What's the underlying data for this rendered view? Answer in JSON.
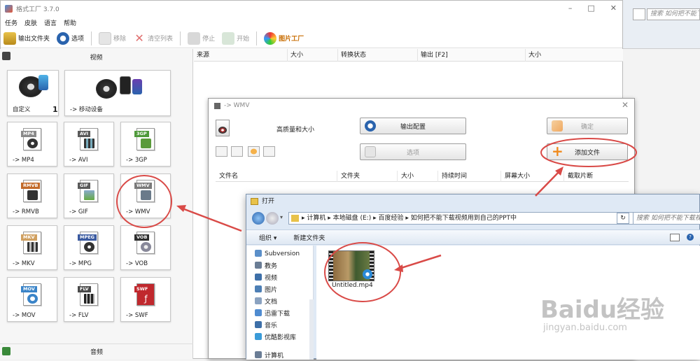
{
  "main_window": {
    "title": "格式工厂 3.7.0",
    "menu": [
      "任务",
      "皮肤",
      "语言",
      "帮助"
    ],
    "toolbar": [
      {
        "label": "输出文件夹",
        "icon": "folder-icon",
        "enabled": true
      },
      {
        "label": "选项",
        "icon": "options-icon",
        "enabled": true
      },
      {
        "label": "移除",
        "icon": "remove-icon",
        "enabled": false
      },
      {
        "label": "清空列表",
        "icon": "clear-list-icon",
        "enabled": false
      },
      {
        "label": "停止",
        "icon": "stop-icon",
        "enabled": false
      },
      {
        "label": "开始",
        "icon": "start-icon",
        "enabled": false
      },
      {
        "label": "图片工厂",
        "icon": "picture-factory-icon",
        "enabled": true
      }
    ],
    "video_section_label": "视频",
    "audio_section_label": "音频",
    "tiles": [
      {
        "label": "自定义",
        "count": "1"
      },
      {
        "label": "-> 移动设备"
      },
      {
        "label": "-> MP4",
        "badge": "MP4",
        "badge_color": "#8a8a8a"
      },
      {
        "label": "-> AVI",
        "badge": "AVI",
        "badge_color": "#5a5a5a"
      },
      {
        "label": "-> 3GP",
        "badge": "3GP",
        "badge_color": "#4f9a3b"
      },
      {
        "label": "-> RMVB",
        "badge": "RMVB",
        "badge_color": "#c26a2a"
      },
      {
        "label": "-> GIF",
        "badge": "GIF",
        "badge_color": "#5a5a5a"
      },
      {
        "label": "-> WMV",
        "badge": "WMV",
        "badge_color": "#7a7a7a"
      },
      {
        "label": "-> MKV",
        "badge": "MKV",
        "badge_color": "#d0a060"
      },
      {
        "label": "-> MPG",
        "badge": "MPEG",
        "badge_color": "#3a5aa0"
      },
      {
        "label": "-> VOB",
        "badge": "VOB",
        "badge_color": "#2e2e2e"
      },
      {
        "label": "-> MOV",
        "badge": "MOV",
        "badge_color": "#3a84c8"
      },
      {
        "label": "-> FLV",
        "badge": "FLV",
        "badge_color": "#4a4a4a"
      },
      {
        "label": "-> SWF",
        "badge": "SWF",
        "badge_color": "#c0282d"
      }
    ],
    "columns": [
      "来源",
      "大小",
      "转换状态",
      "输出 [F2]",
      "大小"
    ]
  },
  "background_window": {
    "search_placeholder": "搜索 如何把不能下"
  },
  "wmv_dialog": {
    "title": "-> WMV",
    "quality_label": "高质量和大小",
    "output_config_button": "输出配置",
    "options_button": "选项",
    "ok_button": "确定",
    "add_file_button": "添加文件",
    "columns": [
      "文件名",
      "文件夹",
      "大小",
      "持续时间",
      "屏幕大小",
      "截取片断"
    ]
  },
  "open_dialog": {
    "title": "打开",
    "breadcrumb": "▸ 计算机 ▸ 本地磁盘 (E:) ▸ 百度经验 ▸ 如何把不能下载视频用到自己的PPT中",
    "search_placeholder": "搜索 如何把不能下载视",
    "organize_label": "组织 ▾",
    "new_folder_label": "新建文件夹",
    "nav_items": [
      {
        "label": "Subversion",
        "color": "#5b8fc9"
      },
      {
        "label": "教务",
        "color": "#6a7d95"
      },
      {
        "label": "视频",
        "color": "#3d6fa8"
      },
      {
        "label": "图片",
        "color": "#4d7fb5"
      },
      {
        "label": "文档",
        "color": "#8aa2c0"
      },
      {
        "label": "迅雷下载",
        "color": "#4f8bd0"
      },
      {
        "label": "音乐",
        "color": "#3d6fa8"
      },
      {
        "label": "优酷影视库",
        "color": "#3a9bd8"
      },
      {
        "label": "计算机",
        "color": "#6a7d95"
      }
    ],
    "file_name": "Untitled.mp4"
  },
  "watermark": {
    "brand": "Baidu经验",
    "url": "jingyan.baidu.com"
  },
  "colors": {
    "annotation_red": "#d94a47",
    "accent_blue": "#2a63ad",
    "add_file_orange": "#f08a1c"
  }
}
